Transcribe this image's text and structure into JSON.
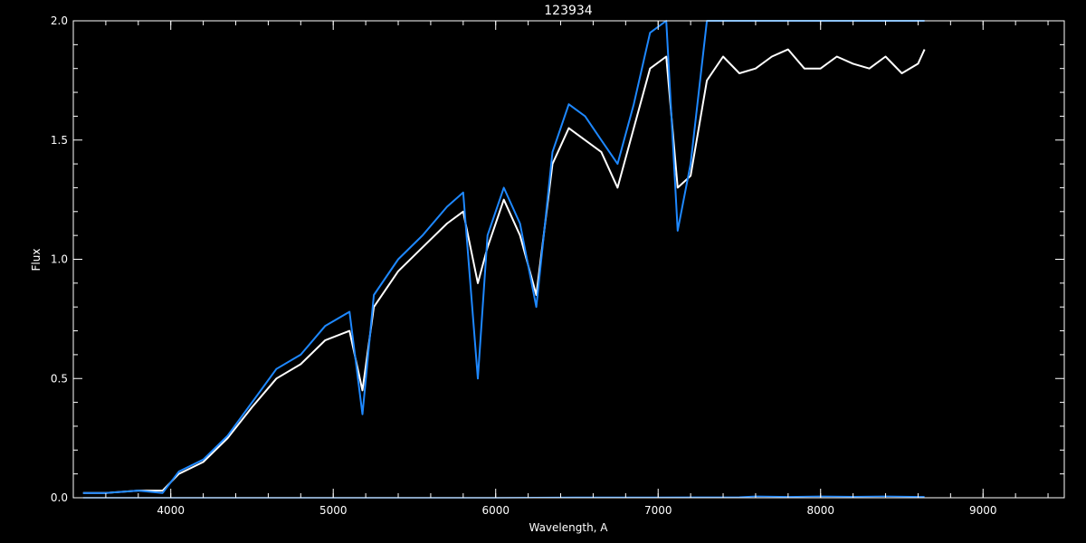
{
  "chart_data": {
    "type": "line",
    "title": "123934",
    "xlabel": "Wavelength, A",
    "ylabel": "Flux",
    "xlim": [
      3400,
      9500
    ],
    "ylim": [
      0.0,
      2.0
    ],
    "x_ticks": [
      4000,
      5000,
      6000,
      7000,
      8000,
      9000
    ],
    "x_tick_labels": [
      "4000",
      "5000",
      "6000",
      "7000",
      "8000",
      "9000"
    ],
    "y_ticks": [
      0.0,
      0.5,
      1.0,
      1.5,
      2.0
    ],
    "y_tick_labels": [
      "0.0",
      "0.5",
      "1.0",
      "1.5",
      "2.0"
    ],
    "grid": false,
    "background": "#000000",
    "axis_color": "#ffffff",
    "series": [
      {
        "color": "#ffffff",
        "x": [
          3460,
          3600,
          3800,
          3950,
          4050,
          4200,
          4350,
          4500,
          4650,
          4800,
          4950,
          5100,
          5180,
          5250,
          5400,
          5550,
          5700,
          5800,
          5890,
          5950,
          6050,
          6150,
          6250,
          6350,
          6450,
          6550,
          6650,
          6750,
          6850,
          6950,
          7050,
          7120,
          7200,
          7300,
          7400,
          7500,
          7600,
          7700,
          7800,
          7900,
          8000,
          8100,
          8200,
          8300,
          8400,
          8500,
          8600,
          8640
        ],
        "y": [
          0.02,
          0.02,
          0.03,
          0.03,
          0.1,
          0.15,
          0.25,
          0.38,
          0.5,
          0.56,
          0.66,
          0.7,
          0.45,
          0.8,
          0.95,
          1.05,
          1.15,
          1.2,
          0.9,
          1.05,
          1.25,
          1.1,
          0.85,
          1.4,
          1.55,
          1.5,
          1.45,
          1.3,
          1.55,
          1.8,
          1.85,
          1.3,
          1.35,
          1.75,
          1.85,
          1.78,
          1.8,
          1.85,
          1.88,
          1.8,
          1.8,
          1.85,
          1.82,
          1.8,
          1.85,
          1.78,
          1.82,
          1.88
        ]
      },
      {
        "color": "#1e88ff",
        "x": [
          3460,
          3600,
          3800,
          3950,
          4050,
          4200,
          4350,
          4500,
          4650,
          4800,
          4950,
          5100,
          5180,
          5250,
          5400,
          5550,
          5700,
          5800,
          5890,
          5950,
          6050,
          6150,
          6250,
          6350,
          6450,
          6550,
          6650,
          6750,
          6850,
          6950,
          7050,
          7120,
          7200,
          7300,
          7400,
          7500,
          7600,
          7700,
          7800,
          7900,
          8000,
          8100,
          8200,
          8300,
          8400,
          8500,
          8600,
          8640
        ],
        "y": [
          0.02,
          0.02,
          0.03,
          0.02,
          0.11,
          0.16,
          0.26,
          0.4,
          0.54,
          0.6,
          0.72,
          0.78,
          0.35,
          0.85,
          1.0,
          1.1,
          1.22,
          1.28,
          0.5,
          1.1,
          1.3,
          1.15,
          0.8,
          1.45,
          1.65,
          1.6,
          1.5,
          1.4,
          1.65,
          1.95,
          2.0,
          1.12,
          1.4,
          2.0,
          2.0,
          2.0,
          2.0,
          2.0,
          2.0,
          2.0,
          2.0,
          2.0,
          2.0,
          2.0,
          2.0,
          2.0,
          2.0,
          2.0
        ]
      },
      {
        "color": "#1e88ff",
        "x": [
          3460,
          4000,
          5000,
          6000,
          6500,
          7000,
          7500,
          7600,
          7800,
          8000,
          8200,
          8400,
          8640
        ],
        "y": [
          0.0,
          0.0,
          0.0,
          0.0,
          0.002,
          0.002,
          0.003,
          0.006,
          0.004,
          0.006,
          0.005,
          0.006,
          0.004
        ]
      }
    ]
  }
}
